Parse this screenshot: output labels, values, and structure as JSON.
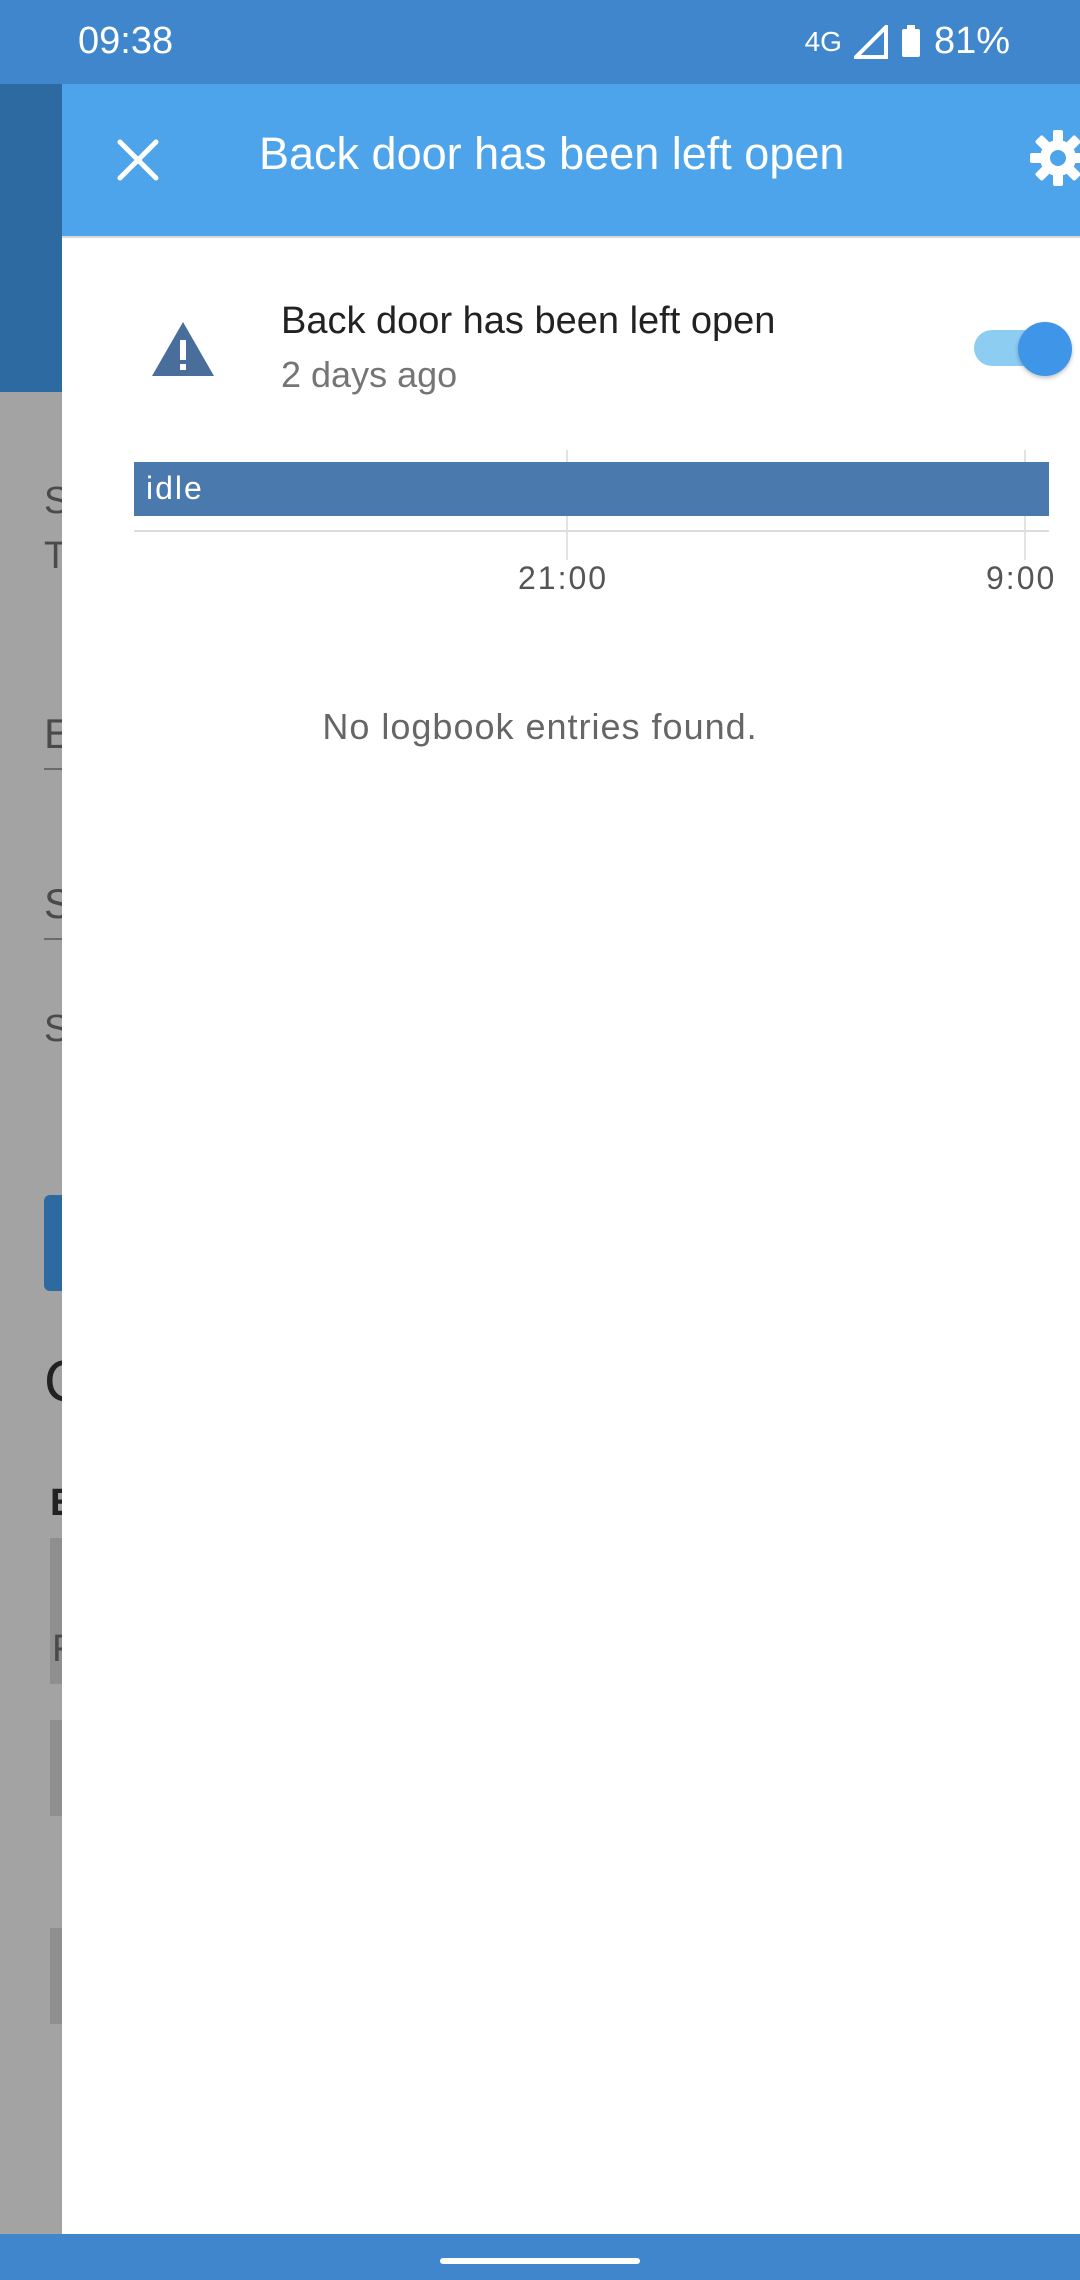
{
  "status_bar": {
    "time": "09:38",
    "network": "4G",
    "battery": "81%",
    "icons": [
      "signal-icon",
      "battery-icon"
    ]
  },
  "dialog": {
    "title": "Back door has been left open",
    "close_icon": "close-icon",
    "settings_icon": "gear-icon"
  },
  "entity": {
    "name": "Back door has been left open",
    "last_changed": "2 days ago",
    "icon": "alert-icon",
    "toggle_on": true
  },
  "timeline": {
    "state": "idle",
    "ticks": [
      "21:00",
      "9:00"
    ]
  },
  "logbook": {
    "empty_message": "No logbook entries found."
  },
  "colors": {
    "primary": "#4ea4eb",
    "status_bar": "#3f86cc",
    "timeline": "#4a79ad"
  }
}
